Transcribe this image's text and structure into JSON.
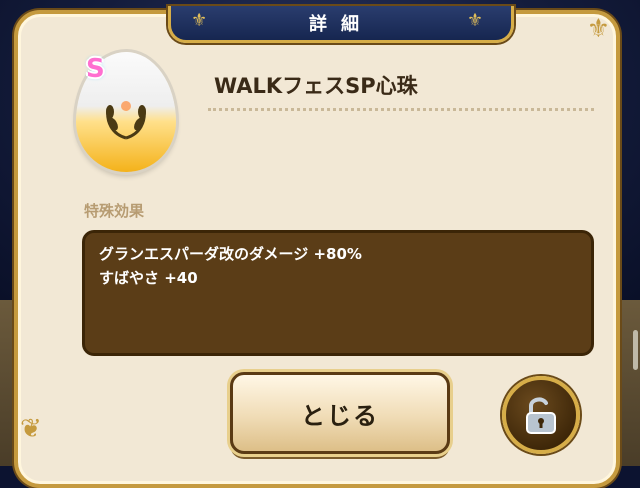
{
  "dialog": {
    "title": "詳細",
    "item_name": "WALKフェスSP心珠",
    "rank": "S",
    "effect_label": "特殊効果",
    "effects": [
      "グランエスパーダ改のダメージ +80%",
      "すばやさ +40"
    ],
    "close_label": "とじる"
  },
  "icons": {
    "item": "egg-heart-orb-icon",
    "lock": "unlocked-padlock-icon"
  },
  "colors": {
    "panel_bg": "#f2e8d5",
    "gold_border": "#c59a3e",
    "effect_box": "#5b3d17",
    "title_tab": "#1e3060"
  }
}
